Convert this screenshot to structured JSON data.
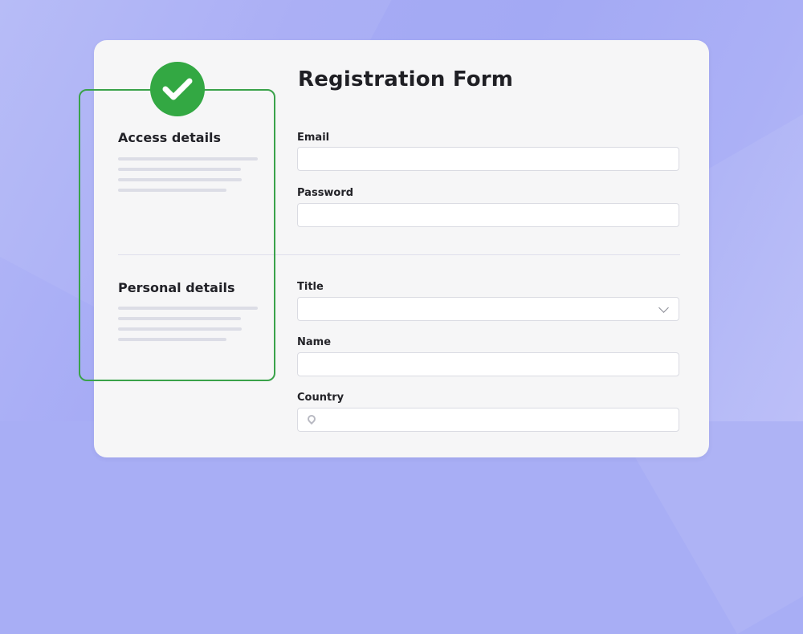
{
  "form": {
    "title": "Registration Form"
  },
  "sections": {
    "access": {
      "heading": "Access details"
    },
    "personal": {
      "heading": "Personal details"
    }
  },
  "fields": {
    "email": {
      "label": "Email",
      "value": ""
    },
    "password": {
      "label": "Password",
      "value": ""
    },
    "title": {
      "label": "Title",
      "selected": "",
      "icon": "chevron-down-icon"
    },
    "name": {
      "label": "Name",
      "value": ""
    },
    "country": {
      "label": "Country",
      "value": "",
      "icon": "location-pin-icon"
    }
  },
  "badge": {
    "icon": "checkmark-icon",
    "state": "completed"
  },
  "colors": {
    "background": "#a8aef5",
    "card": "#f6f6f7",
    "accent_green": "#33a843",
    "highlight_border": "#3aa24a"
  }
}
